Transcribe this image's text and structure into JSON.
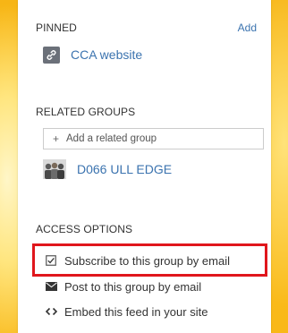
{
  "pinned": {
    "heading": "PINNED",
    "add_label": "Add",
    "items": [
      {
        "label": "CCA website",
        "icon": "link-icon"
      }
    ]
  },
  "related_groups": {
    "heading": "RELATED GROUPS",
    "add_placeholder": "Add a related group",
    "add_icon": "plus",
    "groups": [
      {
        "label": "D066 ULL EDGE",
        "icon": "group-avatar"
      }
    ]
  },
  "access_options": {
    "heading": "ACCESS OPTIONS",
    "options": [
      {
        "label": "Subscribe to this group by email",
        "icon": "checkbox-icon",
        "highlighted": true
      },
      {
        "label": "Post to this group by email",
        "icon": "envelope-icon"
      },
      {
        "label": "Embed this feed in your site",
        "icon": "code-icon"
      }
    ]
  },
  "colors": {
    "link": "#3b73af",
    "highlight": "#e0161c",
    "background": "#fdb813"
  }
}
